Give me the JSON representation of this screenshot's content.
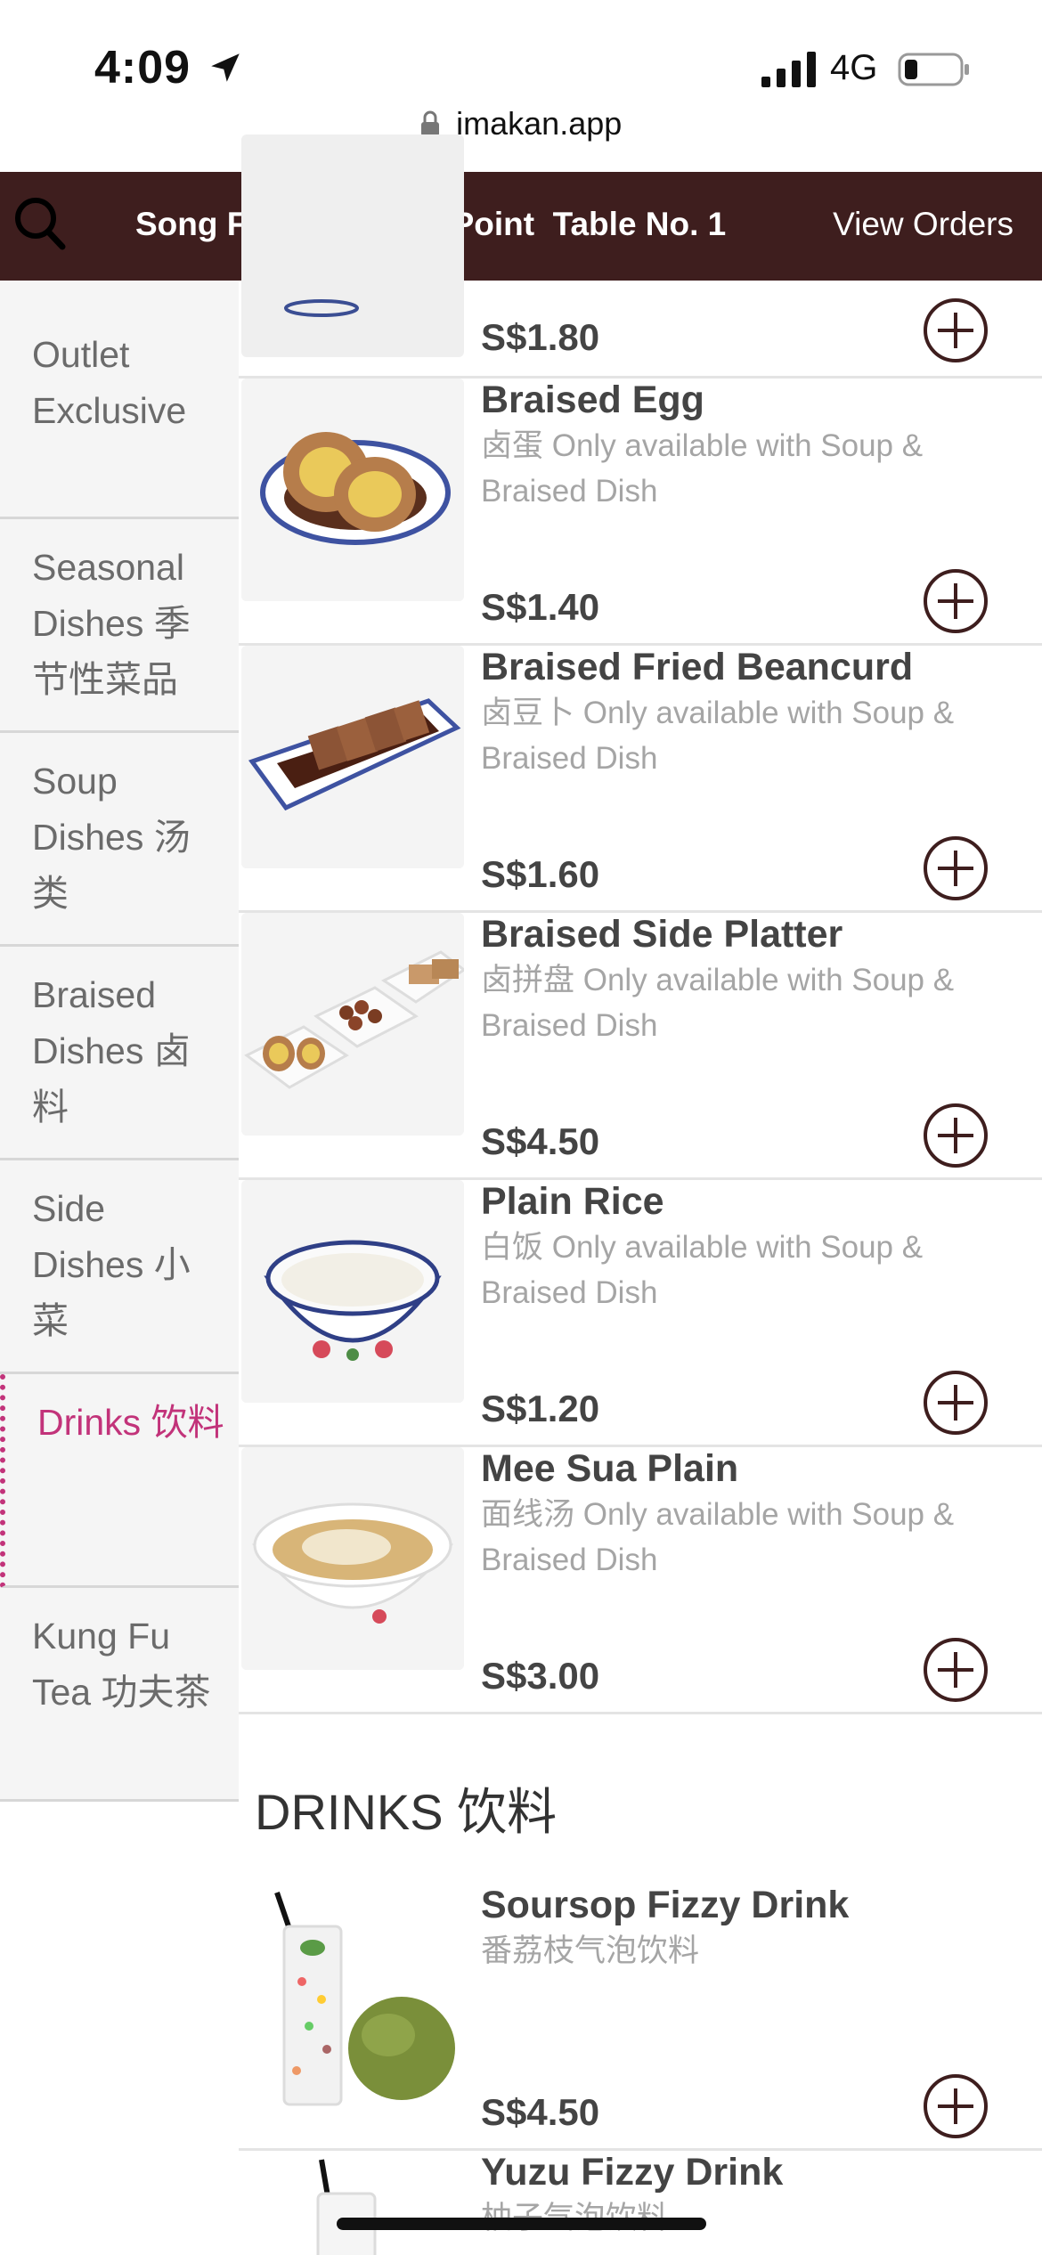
{
  "status": {
    "time": "4:09",
    "network": "4G"
  },
  "browser": {
    "url": "imakan.app"
  },
  "header": {
    "title": "Song Fa Chinatown Point  Table No. 1",
    "view_orders": "View Orders"
  },
  "sidebar": {
    "items": [
      {
        "label": "Outlet Exclusive"
      },
      {
        "label": "Seasonal Dishes 季节性菜品"
      },
      {
        "label": "Soup Dishes 汤类"
      },
      {
        "label": "Braised Dishes 卤料"
      },
      {
        "label": "Side Dishes 小菜"
      },
      {
        "label": "Drinks 饮料"
      },
      {
        "label": "Kung Fu Tea 功夫茶"
      }
    ],
    "active_index": 5
  },
  "menu": {
    "partial_top_price": "S$1.80",
    "items": [
      {
        "name": "Braised Egg",
        "desc": "卤蛋 Only available with Soup & Braised Dish",
        "price": "S$1.40",
        "image": "braised-egg"
      },
      {
        "name": "Braised Fried Beancurd",
        "desc": "卤豆卜 Only available with Soup & Braised Dish",
        "price": "S$1.60",
        "image": "fried-beancurd"
      },
      {
        "name": "Braised Side Platter",
        "desc": "卤拼盘 Only available with Soup & Braised Dish",
        "price": "S$4.50",
        "image": "side-platter"
      },
      {
        "name": "Plain Rice",
        "desc": "白饭 Only available with Soup & Braised Dish",
        "price": "S$1.20",
        "image": "plain-rice"
      },
      {
        "name": "Mee Sua Plain",
        "desc": "面线汤 Only available with Soup & Braised Dish",
        "price": "S$3.00",
        "image": "mee-sua"
      }
    ],
    "section_title": "DRINKS 饮料",
    "drinks": [
      {
        "name": "Soursop Fizzy Drink",
        "desc": "番荔枝气泡饮料",
        "price": "S$4.50",
        "image": "soursop-drink"
      },
      {
        "name": "Yuzu Fizzy Drink",
        "desc": "柚子气泡饮料",
        "image": "yuzu-drink"
      }
    ]
  },
  "colors": {
    "header_bg": "#3e1e1e",
    "accent": "#c2337a",
    "icon": "#3e1e1e"
  }
}
